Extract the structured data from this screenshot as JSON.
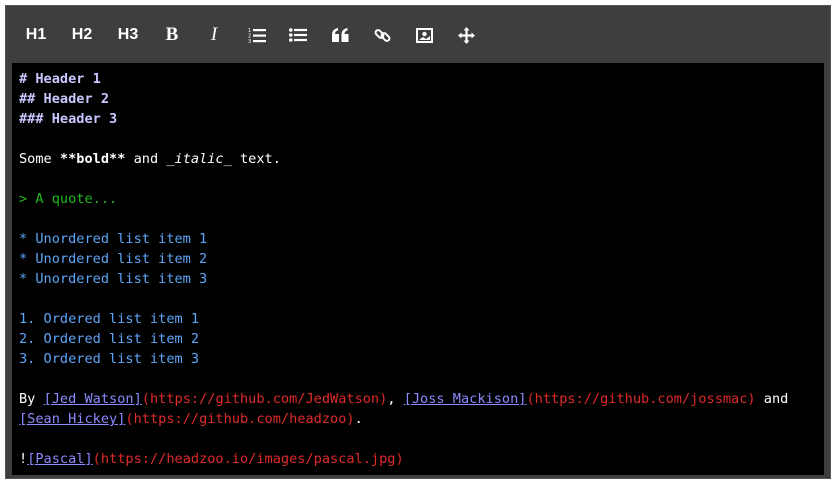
{
  "toolbar": {
    "h1": "H1",
    "h2": "H2",
    "h3": "H3",
    "bold": "B",
    "italic": "I",
    "icons": [
      "ordered-list-icon",
      "unordered-list-icon",
      "quote-icon",
      "link-icon",
      "image-icon",
      "fullscreen-icon"
    ]
  },
  "colors": {
    "toolbar_bg": "#3e3e3e",
    "editor_bg": "#000000",
    "header": "#c8c8ff",
    "quote": "#1fb81f",
    "list": "#5da6f6",
    "link_text": "#8b8bff",
    "url": "#e02a2a"
  },
  "content": {
    "h1": "# Header 1",
    "h2": "## Header 2",
    "h3": "### Header 3",
    "para_prefix": "Some ",
    "para_bold": "**bold**",
    "para_mid": " and ",
    "para_italic": "_italic_",
    "para_suffix": " text.",
    "quote": "> A quote...",
    "ul": [
      "* Unordered list item 1",
      "* Unordered list item 2",
      "* Unordered list item 3"
    ],
    "ol": [
      "1. Ordered list item 1",
      "2. Ordered list item 2",
      "3. Ordered list item 3"
    ],
    "by_prefix": "By ",
    "link1_text": "[Jed Watson]",
    "link1_url": "(https://github.com/JedWatson)",
    "sep1": ", ",
    "link2_text": "[Joss Mackison]",
    "link2_url": "(https://github.com/jossmac)",
    "sep2": " and",
    "link3_text": "[Sean Hickey]",
    "link3_url": "(https://github.com/headzoo)",
    "end": ".",
    "img_bang": "!",
    "img_text": "[Pascal]",
    "img_url": "(https://headzoo.io/images/pascal.jpg)"
  }
}
